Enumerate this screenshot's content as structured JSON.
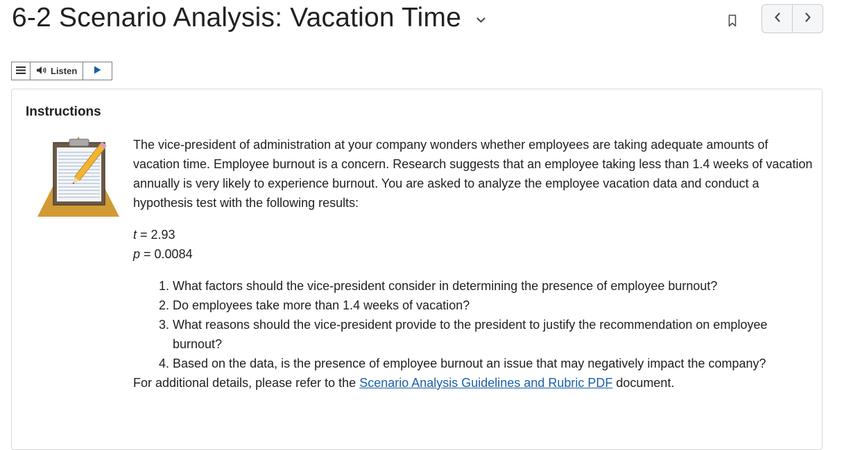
{
  "header": {
    "title": "6-2 Scenario Analysis: Vacation Time",
    "icons": {
      "title_menu": "chevron-down-icon",
      "bookmark": "bookmark-icon",
      "prev": "chevron-left-icon",
      "next": "chevron-right-icon"
    }
  },
  "readspeaker": {
    "listen_label": "Listen",
    "icons": {
      "menu": "menu-icon",
      "speaker": "speaker-icon",
      "play": "play-icon"
    }
  },
  "panel": {
    "heading": "Instructions",
    "image": "clipboard-with-pencil-icon",
    "intro": "The vice-president of administration at your company wonders whether employees are taking adequate amounts of vacation time. Employee burnout is a concern. Research suggests that an employee taking less than 1.4 weeks of vacation annually is very likely to experience burnout. You are asked to analyze the employee vacation data and conduct a hypothesis test with the following results:",
    "stats": [
      {
        "symbol": "t",
        "rest": " = 2.93"
      },
      {
        "symbol": "p",
        "rest": " = 0.0084"
      }
    ],
    "questions": [
      "What factors should the vice-president consider in determining the presence of employee burnout?",
      "Do employees take more than 1.4 weeks of vacation?",
      "What reasons should the vice-president provide to the president to justify the recommendation on employee burnout?",
      "Based on the data, is the presence of employee burnout an issue that may negatively impact the company?"
    ],
    "footer": {
      "before": "For additional details, please refer to the ",
      "link": "Scenario Analysis Guidelines and Rubric PDF",
      "after": " document."
    }
  },
  "colors": {
    "link": "#1a5fa6",
    "text": "#202122",
    "clipboard_triangle": "#d29a34",
    "clipboard_board": "#6a5a4a"
  }
}
